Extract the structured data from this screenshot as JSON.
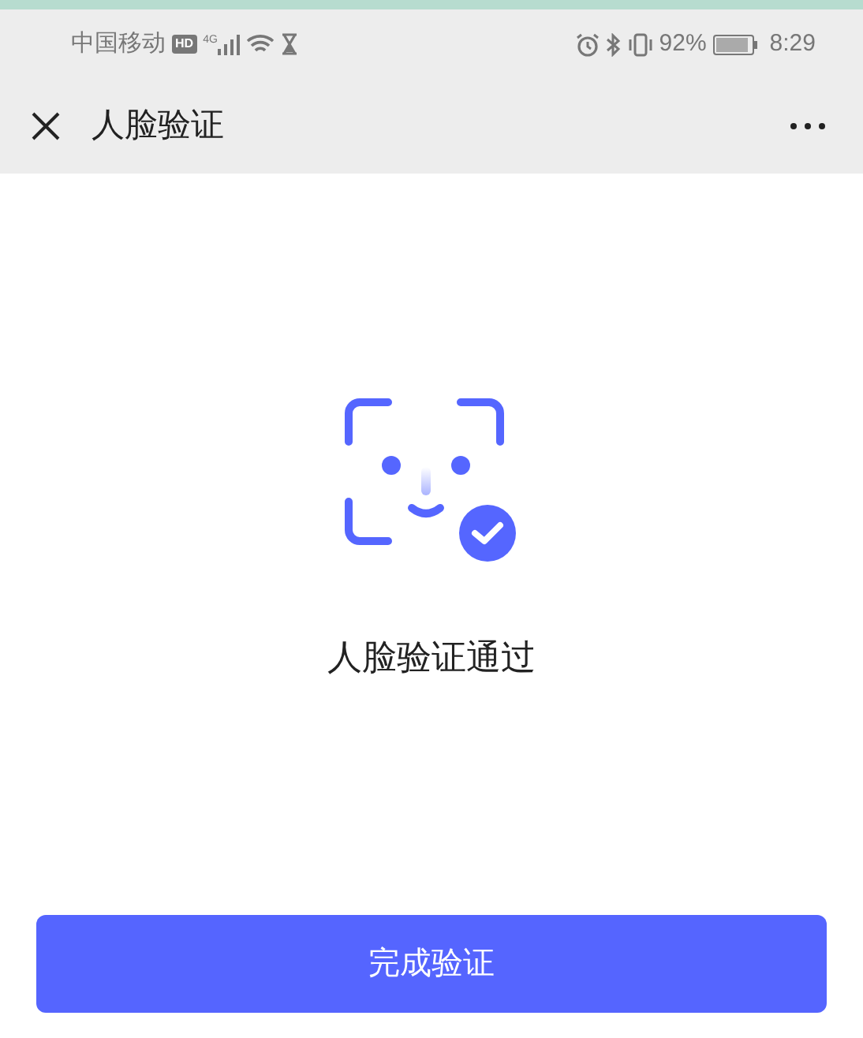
{
  "status_bar": {
    "carrier": "中国移动",
    "hd_badge": "HD",
    "network": "4G",
    "battery_percent": "92%",
    "time": "8:29"
  },
  "nav_bar": {
    "title": "人脸验证"
  },
  "result": {
    "message": "人脸验证通过"
  },
  "button": {
    "label": "完成验证"
  }
}
